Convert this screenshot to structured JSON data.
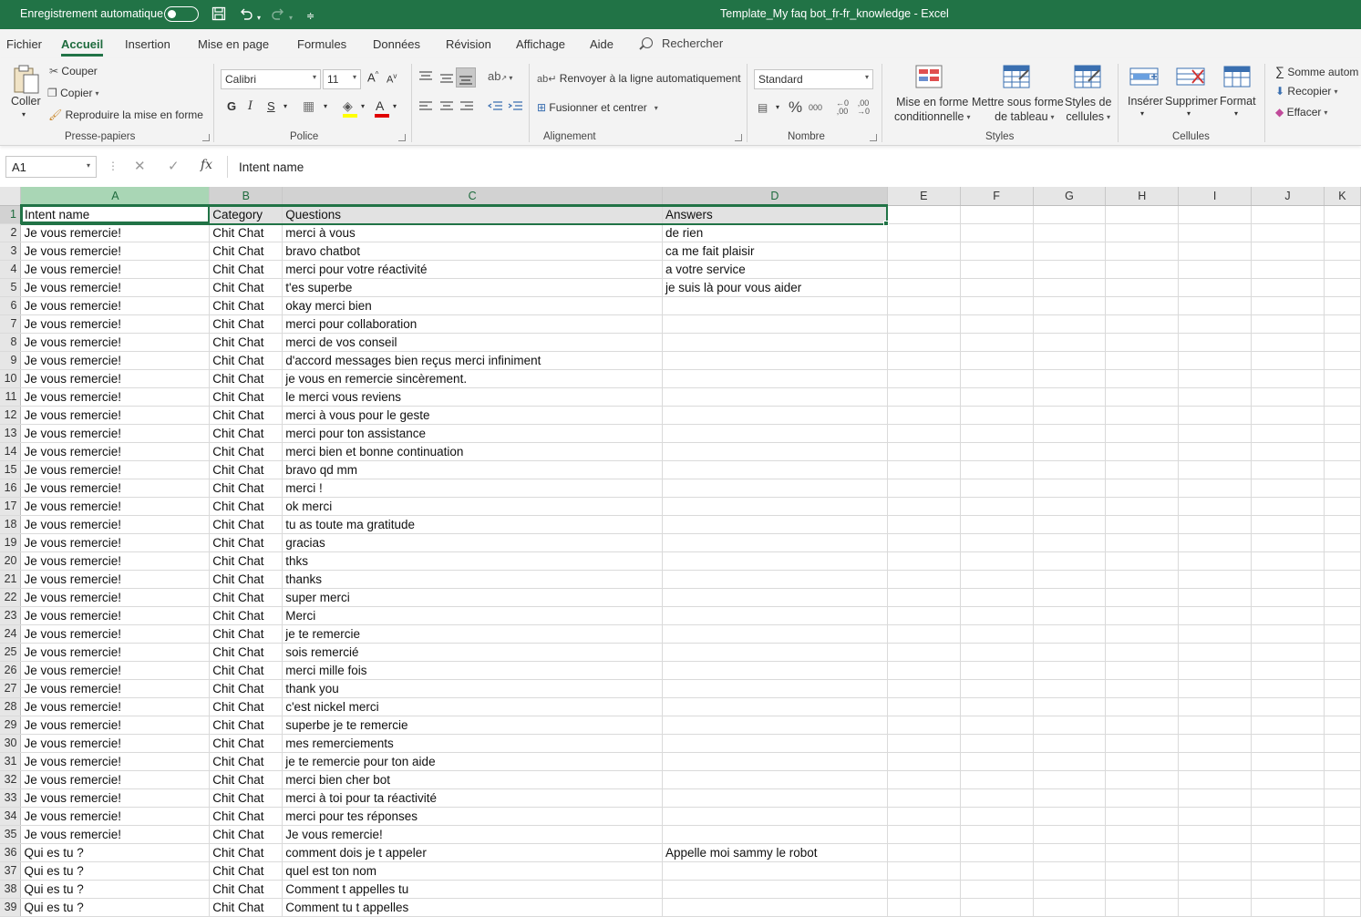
{
  "titlebar": {
    "autosave_label": "Enregistrement automatique",
    "window_title": "Template_My faq bot_fr-fr_knowledge  -  Excel"
  },
  "menu": {
    "tabs": [
      "Fichier",
      "Accueil",
      "Insertion",
      "Mise en page",
      "Formules",
      "Données",
      "Révision",
      "Affichage",
      "Aide"
    ],
    "active": "Accueil",
    "search_label": "Rechercher"
  },
  "ribbon": {
    "clipboard": {
      "paste": "Coller",
      "cut": "Couper",
      "copy": "Copier",
      "format_painter": "Reproduire la mise en forme",
      "label": "Presse-papiers"
    },
    "font": {
      "name": "Calibri",
      "size": "11",
      "label": "Police"
    },
    "alignment": {
      "wrap": "Renvoyer à la ligne automatiquement",
      "merge": "Fusionner et centrer",
      "label": "Alignement"
    },
    "number": {
      "format": "Standard",
      "label": "Nombre"
    },
    "styles": {
      "conditional": "Mise en forme\nconditionnelle",
      "conditional_l1": "Mise en forme",
      "conditional_l2": "conditionnelle",
      "table_l1": "Mettre sous forme",
      "table_l2": "de tableau",
      "cell_l1": "Styles de",
      "cell_l2": "cellules",
      "label": "Styles"
    },
    "cells": {
      "insert": "Insérer",
      "delete": "Supprimer",
      "format": "Format",
      "label": "Cellules"
    },
    "editing": {
      "autosum": "Somme autom",
      "fill": "Recopier",
      "clear": "Effacer"
    }
  },
  "formula_bar": {
    "name_box": "A1",
    "content": "Intent name"
  },
  "sheet": {
    "columns": [
      "A",
      "B",
      "C",
      "D",
      "E",
      "F",
      "G",
      "H",
      "I",
      "J",
      "K"
    ],
    "rows": [
      [
        "Intent name",
        "Category",
        "Questions",
        "Answers"
      ],
      [
        "Je vous remercie!",
        "Chit Chat",
        "merci à vous",
        "de rien"
      ],
      [
        "Je vous remercie!",
        "Chit Chat",
        "bravo chatbot",
        "ca me fait plaisir"
      ],
      [
        "Je vous remercie!",
        "Chit Chat",
        "merci pour votre réactivité",
        "a votre service"
      ],
      [
        "Je vous remercie!",
        "Chit Chat",
        "t'es superbe",
        "je suis là pour vous aider"
      ],
      [
        "Je vous remercie!",
        "Chit Chat",
        "okay merci bien",
        ""
      ],
      [
        "Je vous remercie!",
        "Chit Chat",
        "merci pour collaboration",
        ""
      ],
      [
        "Je vous remercie!",
        "Chit Chat",
        "merci de vos conseil",
        ""
      ],
      [
        "Je vous remercie!",
        "Chit Chat",
        "d'accord messages bien reçus merci infiniment",
        ""
      ],
      [
        "Je vous remercie!",
        "Chit Chat",
        "je vous en remercie sincèrement.",
        ""
      ],
      [
        "Je vous remercie!",
        "Chit Chat",
        "le merci vous reviens",
        ""
      ],
      [
        "Je vous remercie!",
        "Chit Chat",
        "merci à vous pour le geste",
        ""
      ],
      [
        "Je vous remercie!",
        "Chit Chat",
        "merci pour ton assistance",
        ""
      ],
      [
        "Je vous remercie!",
        "Chit Chat",
        "merci bien et bonne continuation",
        ""
      ],
      [
        "Je vous remercie!",
        "Chit Chat",
        "bravo qd mm",
        ""
      ],
      [
        "Je vous remercie!",
        "Chit Chat",
        "merci !",
        ""
      ],
      [
        "Je vous remercie!",
        "Chit Chat",
        "ok merci",
        ""
      ],
      [
        "Je vous remercie!",
        "Chit Chat",
        "tu as toute ma gratitude",
        ""
      ],
      [
        "Je vous remercie!",
        "Chit Chat",
        "gracias",
        ""
      ],
      [
        "Je vous remercie!",
        "Chit Chat",
        "thks",
        ""
      ],
      [
        "Je vous remercie!",
        "Chit Chat",
        "thanks",
        ""
      ],
      [
        "Je vous remercie!",
        "Chit Chat",
        "super merci",
        ""
      ],
      [
        "Je vous remercie!",
        "Chit Chat",
        "Merci",
        ""
      ],
      [
        "Je vous remercie!",
        "Chit Chat",
        "je te remercie",
        ""
      ],
      [
        "Je vous remercie!",
        "Chit Chat",
        "sois remercié",
        ""
      ],
      [
        "Je vous remercie!",
        "Chit Chat",
        "merci mille fois",
        ""
      ],
      [
        "Je vous remercie!",
        "Chit Chat",
        "thank you",
        ""
      ],
      [
        "Je vous remercie!",
        "Chit Chat",
        "c'est nickel merci",
        ""
      ],
      [
        "Je vous remercie!",
        "Chit Chat",
        "superbe je te remercie",
        ""
      ],
      [
        "Je vous remercie!",
        "Chit Chat",
        "mes remerciements",
        ""
      ],
      [
        "Je vous remercie!",
        "Chit Chat",
        "je te remercie pour ton aide",
        ""
      ],
      [
        "Je vous remercie!",
        "Chit Chat",
        "merci bien cher bot",
        ""
      ],
      [
        "Je vous remercie!",
        "Chit Chat",
        "merci à toi pour ta réactivité",
        ""
      ],
      [
        "Je vous remercie!",
        "Chit Chat",
        "merci pour tes réponses",
        ""
      ],
      [
        "Je vous remercie!",
        "Chit Chat",
        "Je vous remercie!",
        ""
      ],
      [
        "Qui es tu ?",
        "Chit Chat",
        "comment dois je t appeler",
        "Appelle moi sammy le robot"
      ],
      [
        "Qui es tu ?",
        "Chit Chat",
        "quel est ton nom",
        ""
      ],
      [
        "Qui es tu ?",
        "Chit Chat",
        "Comment t appelles tu",
        ""
      ],
      [
        "Qui es tu ?",
        "Chit Chat",
        "Comment tu t appelles",
        ""
      ]
    ]
  },
  "colors": {
    "excel_green": "#217346",
    "ribbon_bg": "#f3f3f3",
    "header_bg": "#e6e6e6"
  }
}
